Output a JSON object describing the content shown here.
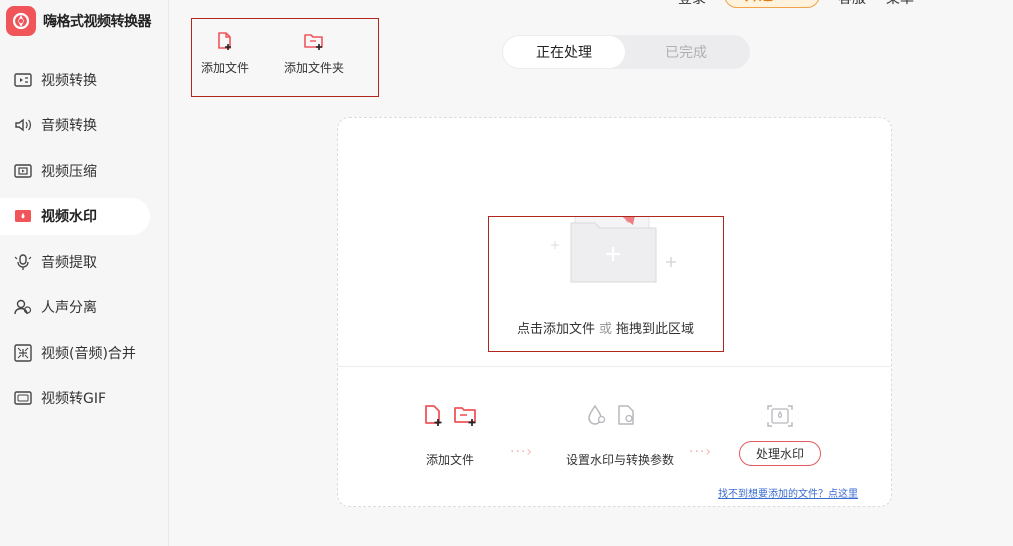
{
  "app": {
    "title": "嗨格式视频转换器"
  },
  "header": {
    "login": "登录",
    "vip": "开通VIP",
    "service": "客服",
    "menu": "菜单"
  },
  "sidebar": {
    "items": [
      {
        "label": "视频转换",
        "icon": "video-convert-icon"
      },
      {
        "label": "音频转换",
        "icon": "audio-convert-icon"
      },
      {
        "label": "视频压缩",
        "icon": "video-compress-icon"
      },
      {
        "label": "视频水印",
        "icon": "video-watermark-icon",
        "active": true
      },
      {
        "label": "音频提取",
        "icon": "audio-extract-icon"
      },
      {
        "label": "人声分离",
        "icon": "voice-separate-icon"
      },
      {
        "label": "视频(音频)合并",
        "icon": "merge-icon"
      },
      {
        "label": "视频转GIF",
        "icon": "gif-icon"
      }
    ]
  },
  "toolbar": {
    "add_file": "添加文件",
    "add_folder": "添加文件夹"
  },
  "tabs": {
    "processing": "正在处理",
    "completed": "已完成"
  },
  "dropzone": {
    "click_add": "点击添加文件",
    "or": "或",
    "drag_here": "拖拽到此区域"
  },
  "steps": {
    "step1": "添加文件",
    "step2": "设置水印与转换参数",
    "step3": "处理水印"
  },
  "help": {
    "link": "找不到想要添加的文件？点这里"
  },
  "colors": {
    "accent": "#f0555a",
    "highlight_border": "#b3261e",
    "vip": "#e07b12"
  }
}
